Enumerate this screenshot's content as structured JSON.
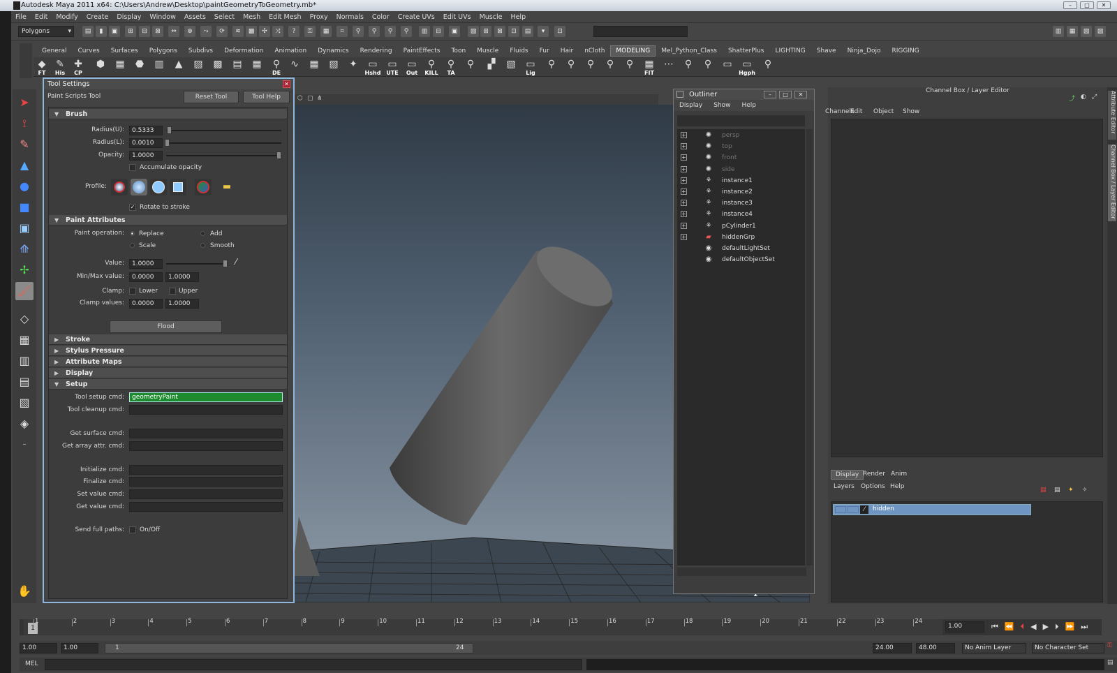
{
  "window": {
    "title": "Autodesk Maya 2011 x64: C:\\Users\\Andrew\\Desktop\\paintGeometryToGeometry.mb*"
  },
  "menubar": [
    "File",
    "Edit",
    "Modify",
    "Create",
    "Display",
    "Window",
    "Assets",
    "Select",
    "Mesh",
    "Edit Mesh",
    "Proxy",
    "Normals",
    "Color",
    "Create UVs",
    "Edit UVs",
    "Muscle",
    "Help"
  ],
  "status_line": {
    "menu_set": "Polygons"
  },
  "shelf_tabs": [
    "General",
    "Curves",
    "Surfaces",
    "Polygons",
    "Subdivs",
    "Deformation",
    "Animation",
    "Dynamics",
    "Rendering",
    "PaintEffects",
    "Toon",
    "Muscle",
    "Fluids",
    "Fur",
    "Hair",
    "nCloth",
    "MODELING",
    "Mel_Python_Class",
    "ShatterPlus",
    "LIGHTING",
    "Shave",
    "Ninja_Dojo",
    "RIGGING"
  ],
  "shelf_active": "MODELING",
  "shelf_labels": [
    "FT",
    "His",
    "CP",
    "DE",
    "Hshd",
    "UTE",
    "Out",
    "KILL",
    "TA",
    "Lig",
    "FIT",
    "Hgph"
  ],
  "tool_settings": {
    "title": "Tool Settings",
    "tool_name": "Paint Scripts Tool",
    "reset_label": "Reset Tool",
    "help_label": "Tool Help",
    "brush": {
      "header": "Brush",
      "radius_u_label": "Radius(U):",
      "radius_u": "0.5333",
      "radius_l_label": "Radius(L):",
      "radius_l": "0.0010",
      "opacity_label": "Opacity:",
      "opacity": "1.0000",
      "accumulate_label": "Accumulate opacity",
      "profile_label": "Profile:",
      "rotate_label": "Rotate to stroke"
    },
    "paint_attributes": {
      "header": "Paint Attributes",
      "operation_label": "Paint operation:",
      "ops": [
        "Replace",
        "Add",
        "Scale",
        "Smooth"
      ],
      "value_label": "Value:",
      "value": "1.0000",
      "minmax_label": "Min/Max value:",
      "min": "0.0000",
      "max": "1.0000",
      "clamp_label": "Clamp:",
      "lower": "Lower",
      "upper": "Upper",
      "clamp_values_label": "Clamp values:",
      "clamp_min": "0.0000",
      "clamp_max": "1.0000",
      "flood_label": "Flood"
    },
    "sections": [
      "Stroke",
      "Stylus Pressure",
      "Attribute Maps",
      "Display",
      "Setup"
    ],
    "setup": {
      "tool_setup_label": "Tool setup cmd:",
      "tool_setup": "geometryPaint",
      "tool_cleanup_label": "Tool cleanup cmd:",
      "get_surface_label": "Get surface cmd:",
      "get_array_label": "Get array attr. cmd:",
      "initialize_label": "Initialize cmd:",
      "finalize_label": "Finalize cmd:",
      "set_value_label": "Set value cmd:",
      "get_value_label": "Get value cmd:",
      "full_paths_label": "Send full paths:",
      "onoff": "On/Off"
    }
  },
  "outliner": {
    "title": "Outliner",
    "menu": [
      "Display",
      "Show",
      "Help"
    ],
    "items": [
      {
        "name": "persp",
        "icon": "camera",
        "dim": true,
        "expand": true
      },
      {
        "name": "top",
        "icon": "camera",
        "dim": true,
        "expand": true
      },
      {
        "name": "front",
        "icon": "camera",
        "dim": true,
        "expand": true
      },
      {
        "name": "side",
        "icon": "camera",
        "dim": true,
        "expand": true
      },
      {
        "name": "instance1",
        "icon": "transform",
        "dim": false,
        "expand": true
      },
      {
        "name": "instance2",
        "icon": "transform",
        "dim": false,
        "expand": true
      },
      {
        "name": "instance3",
        "icon": "transform",
        "dim": false,
        "expand": true
      },
      {
        "name": "instance4",
        "icon": "transform",
        "dim": false,
        "expand": true
      },
      {
        "name": "pCylinder1",
        "icon": "transform",
        "dim": false,
        "expand": true
      },
      {
        "name": "hiddenGrp",
        "icon": "group",
        "dim": false,
        "expand": true
      },
      {
        "name": "defaultLightSet",
        "icon": "set",
        "dim": false,
        "expand": false
      },
      {
        "name": "defaultObjectSet",
        "icon": "set",
        "dim": false,
        "expand": false
      }
    ]
  },
  "channel_box": {
    "title": "Channel Box / Layer Editor",
    "menu": [
      "Channels",
      "Edit",
      "Object",
      "Show"
    ],
    "layer_tabs": [
      "Display",
      "Render",
      "Anim"
    ],
    "layer_menu": [
      "Layers",
      "Options",
      "Help"
    ],
    "layer_name": "hidden",
    "side_tabs": [
      "Attribute Editor",
      "Channel Box / Layer Editor"
    ]
  },
  "viewport": {
    "frame_label": "1"
  },
  "timeline": {
    "ticks": [
      "1",
      "2",
      "3",
      "4",
      "5",
      "6",
      "7",
      "8",
      "9",
      "10",
      "11",
      "12",
      "13",
      "14",
      "15",
      "16",
      "17",
      "18",
      "19",
      "20",
      "21",
      "22",
      "23",
      "24"
    ],
    "current_frame": "1",
    "current_time": "1.00",
    "range": {
      "start": "1.00",
      "playback_start": "1.00",
      "slider_start": "1",
      "slider_end": "24",
      "playback_end": "24.00",
      "end": "48.00"
    },
    "anim_layer": "No Anim Layer",
    "character_set": "No Character Set"
  },
  "command_line": {
    "label": "MEL"
  },
  "colors": {
    "accent": "#8fb6dc",
    "setup_field_bg": "#1e8a2e",
    "layer_sel": "#6f95c2"
  }
}
